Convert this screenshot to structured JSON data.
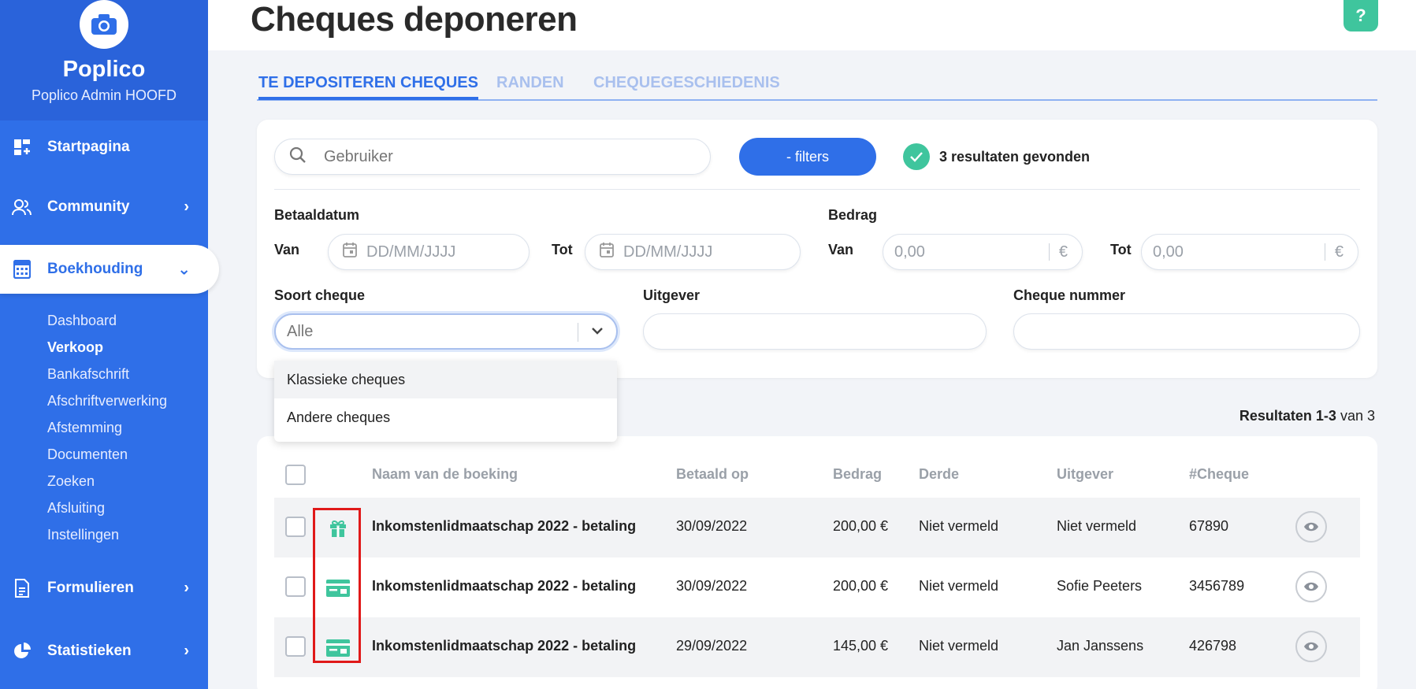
{
  "app": {
    "name": "Poplico",
    "subtitle": "Poplico Admin HOOFD"
  },
  "sidebar": {
    "items": [
      {
        "label": "Startpagina",
        "icon": "dashboard-icon"
      },
      {
        "label": "Community",
        "icon": "users-icon"
      },
      {
        "label": "Boekhouding",
        "icon": "calculator-icon"
      },
      {
        "label": "Formulieren",
        "icon": "document-icon"
      },
      {
        "label": "Statistieken",
        "icon": "pie-chart-icon"
      }
    ],
    "subitems": [
      "Dashboard",
      "Verkoop",
      "Bankafschrift",
      "Afschriftverwerking",
      "Afstemming",
      "Documenten",
      "Zoeken",
      "Afsluiting",
      "Instellingen"
    ]
  },
  "page": {
    "title": "Cheques deponeren",
    "help": "?"
  },
  "tabs": [
    "TE DEPOSITEREN CHEQUES",
    "RANDEN",
    "CHEQUEGESCHIEDENIS"
  ],
  "filters": {
    "search_placeholder": "Gebruiker",
    "filters_button": "- filters",
    "results_text": "3 resultaten gevonden",
    "betaaldatum_label": "Betaaldatum",
    "bedrag_label": "Bedrag",
    "van": "Van",
    "tot": "Tot",
    "date_placeholder": "DD/MM/JJJJ",
    "amount_placeholder": "0,00",
    "currency": "€",
    "soort_label": "Soort cheque",
    "soort_value": "Alle",
    "uitgever_label": "Uitgever",
    "cheque_nummer_label": "Cheque nummer",
    "options": [
      "Klassieke cheques",
      "Andere cheques"
    ]
  },
  "pagination": {
    "prefix": "Resultaten",
    "range": "1-3",
    "suffix": "van 3"
  },
  "table": {
    "headers": [
      "Naam van de boeking",
      "Betaald op",
      "Bedrag",
      "Derde",
      "Uitgever",
      "#Cheque"
    ],
    "rows": [
      {
        "name": "Inkomstenlidmaatschap 2022 - betaling",
        "date": "30/09/2022",
        "amount": "200,00 €",
        "third": "Niet vermeld",
        "issuer": "Niet vermeld",
        "cheque": "67890",
        "type_icon": "gift-icon"
      },
      {
        "name": "Inkomstenlidmaatschap 2022 - betaling",
        "date": "30/09/2022",
        "amount": "200,00 €",
        "third": "Niet vermeld",
        "issuer": "Sofie Peeters",
        "cheque": "3456789",
        "type_icon": "card-icon"
      },
      {
        "name": "Inkomstenlidmaatschap 2022 - betaling",
        "date": "29/09/2022",
        "amount": "145,00 €",
        "third": "Niet vermeld",
        "issuer": "Jan Janssens",
        "cheque": "426798",
        "type_icon": "card-icon"
      }
    ]
  },
  "colors": {
    "primary": "#2f6fe8",
    "success": "#3fc59d",
    "highlight": "#e01919"
  }
}
